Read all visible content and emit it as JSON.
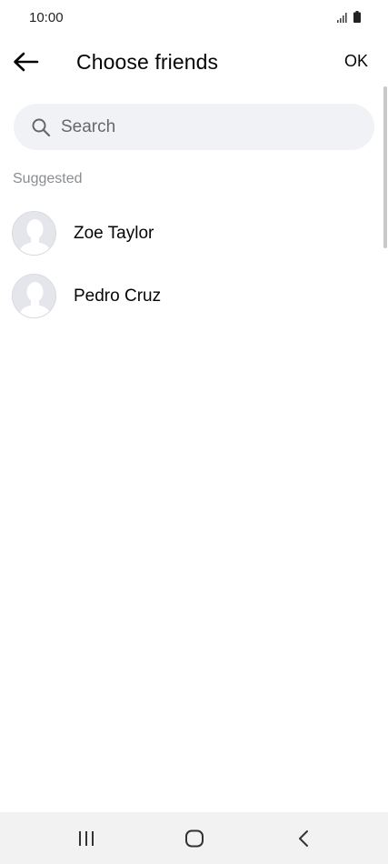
{
  "status_bar": {
    "time": "10:00"
  },
  "header": {
    "title": "Choose friends",
    "ok_label": "OK"
  },
  "search": {
    "placeholder": "Search"
  },
  "suggested": {
    "label": "Suggested",
    "friends": [
      {
        "name": "Zoe Taylor"
      },
      {
        "name": "Pedro Cruz"
      }
    ]
  },
  "icons": {
    "back": "arrow-left-icon",
    "search": "magnifier-icon",
    "avatar": "default-profile-silhouette",
    "nav_recents": "recents-icon",
    "nav_home": "home-icon",
    "nav_back": "chevron-left-icon"
  }
}
